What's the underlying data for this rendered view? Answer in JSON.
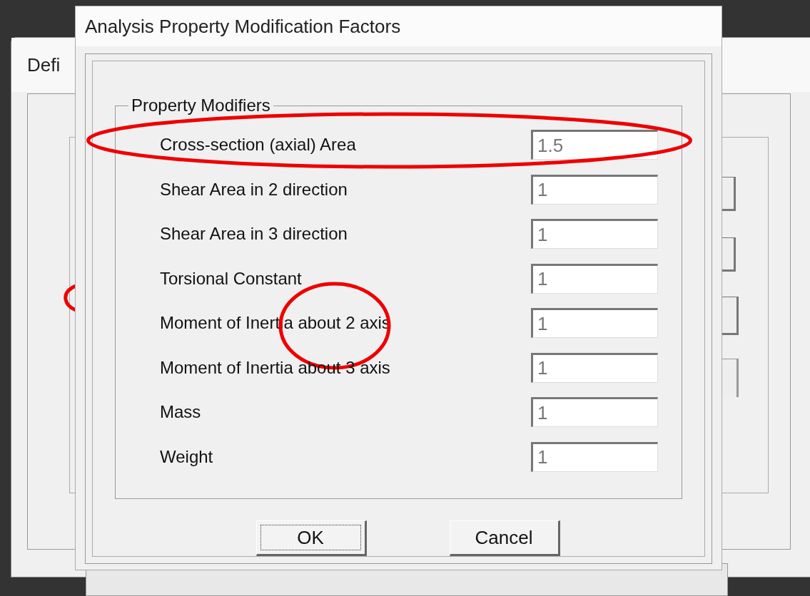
{
  "background_window": {
    "title": "Defi"
  },
  "dialog": {
    "title": "Analysis Property Modification Factors",
    "group": {
      "title": "Property Modifiers",
      "rows": [
        {
          "label": "Cross-section (axial) Area",
          "value": "1.5",
          "outlined": true,
          "circled": false
        },
        {
          "label": "Shear Area in 2 direction",
          "value": "1",
          "outlined": false,
          "circled": false
        },
        {
          "label": "Shear Area in 3 direction",
          "value": "1",
          "outlined": false,
          "circled": false
        },
        {
          "label": "Torsional Constant",
          "value": "1",
          "outlined": false,
          "circled": false
        },
        {
          "label": "Moment of Inertia about 2 axis",
          "value": "1",
          "outlined": false,
          "circled": true
        },
        {
          "label": "Moment of Inertia about 3 axis",
          "value": "1",
          "outlined": false,
          "circled": false
        },
        {
          "label": "Mass",
          "value": "1",
          "outlined": false,
          "circled": false
        },
        {
          "label": "Weight",
          "value": "1",
          "outlined": false,
          "circled": false
        }
      ]
    },
    "buttons": [
      {
        "label": "OK",
        "focused": true
      },
      {
        "label": "Cancel",
        "focused": false
      }
    ]
  }
}
